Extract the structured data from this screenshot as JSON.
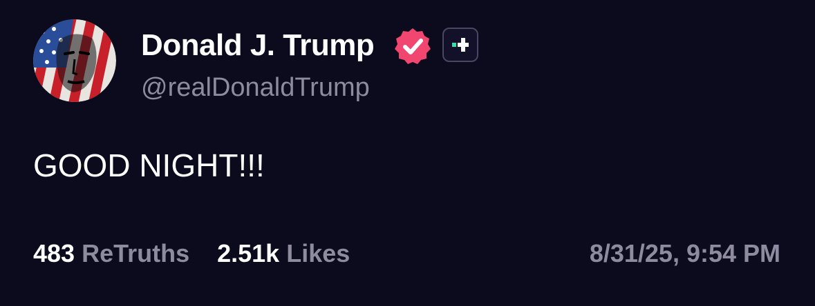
{
  "post": {
    "author": {
      "display_name": "Donald J. Trump",
      "handle": "@realDonaldTrump",
      "avatar_icon": "flag-portrait-avatar",
      "verified_icon": "verified-badge-icon",
      "plus_icon": "plus-badge-icon"
    },
    "text": "GOOD NIGHT!!!",
    "stats": {
      "retruths_count": "483",
      "retruths_label": "ReTruths",
      "likes_count": "2.51k",
      "likes_label": "Likes"
    },
    "timestamp": "8/31/25, 9:54 PM"
  },
  "colors": {
    "background": "#0c0a1d",
    "verified_pink": "#f0466f",
    "plus_green": "#36e0a8",
    "muted_text": "#8e8a9f"
  }
}
